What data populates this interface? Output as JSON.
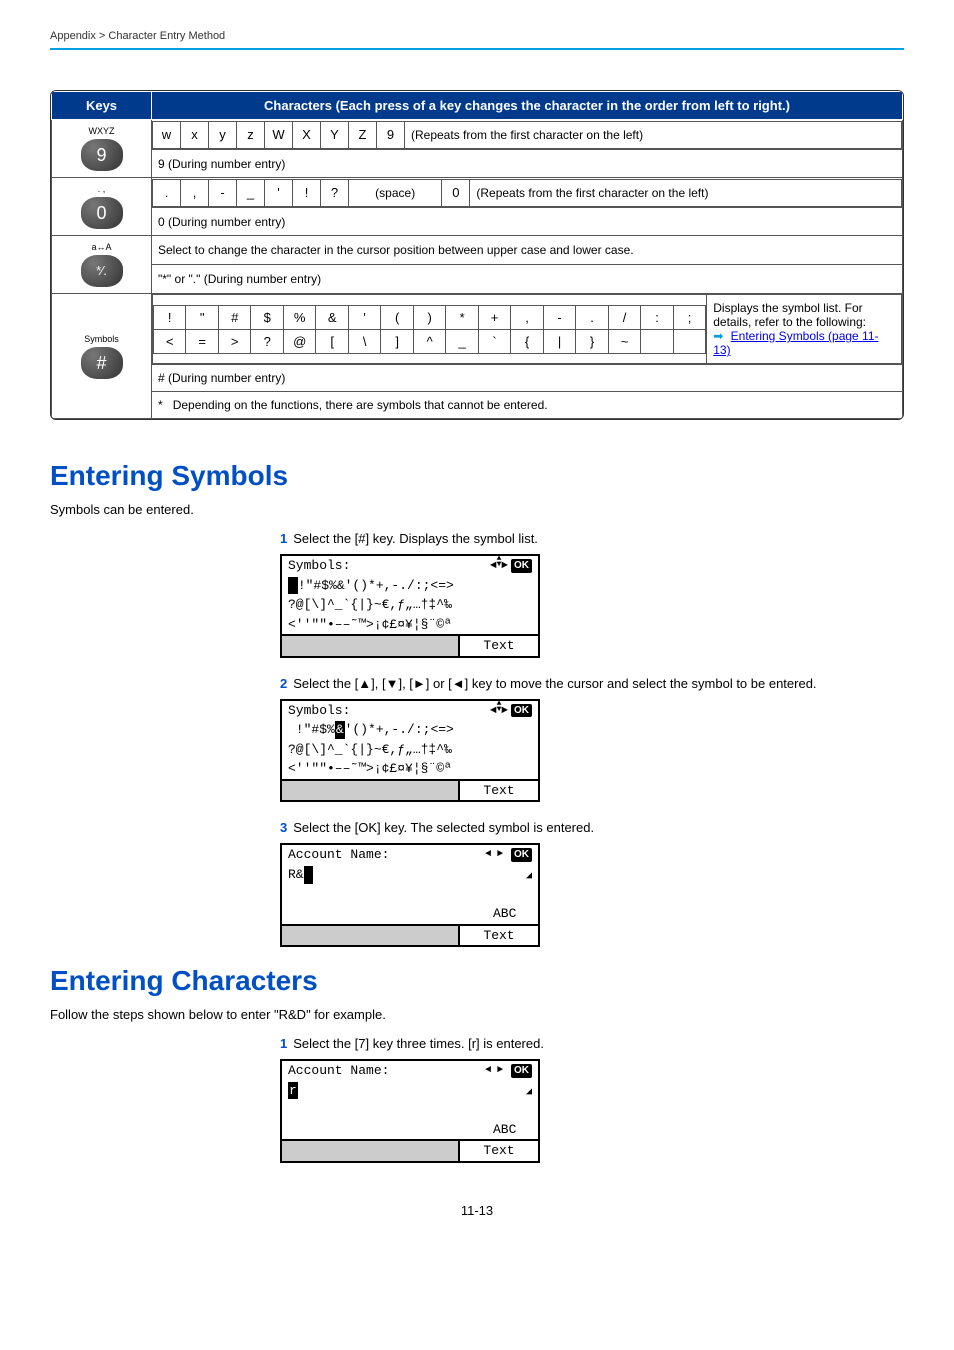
{
  "breadcrumb": "Appendix > Character Entry Method",
  "table": {
    "header_keys": "Keys",
    "header_chars": "Characters (Each press of a key changes the character in the order from left to right.)",
    "row9": {
      "key_label": "WXYZ",
      "key_face": "9",
      "chars": [
        "w",
        "x",
        "y",
        "z",
        "W",
        "X",
        "Y",
        "Z",
        "9"
      ],
      "repeat": "(Repeats from the first character on the left)",
      "numline": "9 (During number entry)"
    },
    "row0": {
      "key_label": ". ,",
      "key_face": "0",
      "chars": [
        ".",
        ",",
        "-",
        "_",
        "'",
        "!",
        "?"
      ],
      "space": "(space)",
      "zero": "0",
      "repeat": "(Repeats from the first character on the left)",
      "numline": "0 (During number entry)"
    },
    "rowCase": {
      "key_label": "a↔A",
      "key_face": "*⁄.",
      "line1": "Select to change the character in the cursor position between upper case and lower case.",
      "line2": "\"*\" or \".\" (During number entry)"
    },
    "rowSym": {
      "key_label": "Symbols",
      "key_face": "#",
      "r1": [
        "!",
        "\"",
        "#",
        "$",
        "%",
        "&",
        "'",
        "(",
        ")",
        "*",
        "+",
        ",",
        "-",
        ".",
        "/",
        ":",
        ";"
      ],
      "r2": [
        "<",
        "=",
        ">",
        "?",
        "@",
        "[",
        "\\",
        "]",
        "^",
        "_",
        "`",
        "{",
        "|",
        "}",
        "~"
      ],
      "side_text": "Displays the symbol list. For details, refer to the following:",
      "side_link": "Entering Symbols (page 11-13)",
      "numline": "# (During number entry)",
      "note_star": "*",
      "note": "Depending on the functions, there are symbols that cannot be entered."
    }
  },
  "entering_symbols": {
    "heading": "Entering Symbols",
    "intro": "Symbols can be entered.",
    "step1": "Select the [#] key. Displays the symbol list.",
    "step2": "Select the [▲], [▼], [►] or [◄] key to move the cursor and select the symbol to be entered.",
    "step3": "Select the [OK] key. The selected symbol is entered.",
    "lcd": {
      "title": "Symbols:",
      "line1a": "!\"#$%&'()*+,-./:;<=>",
      "line1b": "!\"#$%&'()*+,-./:;<=>",
      "line2": "?@[\\]^_`{|}~€,ƒ„…†‡^‰",
      "line3": "<''\"\"•––˜™>¡¢£¤¥¦§¨©ª",
      "soft_right": "Text",
      "acct_title": "Account Name:",
      "acct_val": "R&",
      "abc": "ABC"
    }
  },
  "entering_characters": {
    "heading": "Entering Characters",
    "intro": "Follow the steps shown below to enter \"R&D\" for example.",
    "step1": "Select the [7] key three times. [r] is entered.",
    "lcd": {
      "title": "Account Name:",
      "val": "r",
      "abc": "ABC",
      "text": "Text"
    }
  },
  "page_num": "11-13"
}
